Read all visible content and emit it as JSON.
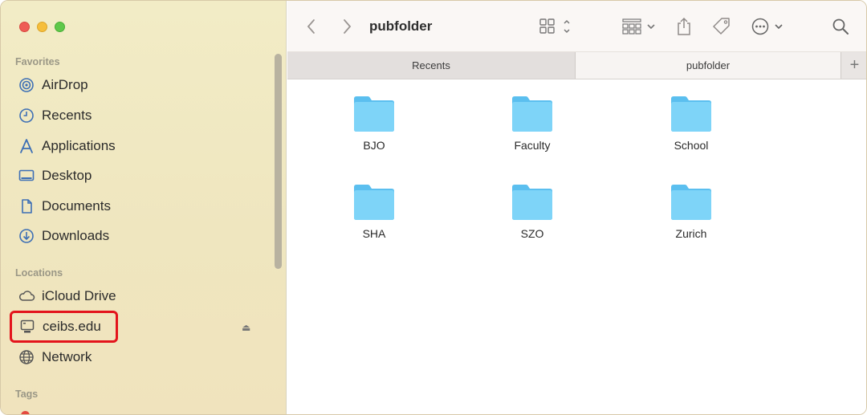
{
  "sidebar": {
    "favorites_title": "Favorites",
    "favorites": [
      {
        "label": "AirDrop",
        "icon": "airdrop-icon"
      },
      {
        "label": "Recents",
        "icon": "clock-icon"
      },
      {
        "label": "Applications",
        "icon": "applications-icon"
      },
      {
        "label": "Desktop",
        "icon": "desktop-icon"
      },
      {
        "label": "Documents",
        "icon": "document-icon"
      },
      {
        "label": "Downloads",
        "icon": "download-icon"
      }
    ],
    "locations_title": "Locations",
    "locations": [
      {
        "label": "iCloud Drive",
        "icon": "cloud-icon"
      },
      {
        "label": "ceibs.edu",
        "icon": "server-icon"
      },
      {
        "label": "Network",
        "icon": "globe-icon"
      }
    ],
    "tags_title": "Tags"
  },
  "toolbar": {
    "title": "pubfolder"
  },
  "tabs": {
    "items": [
      {
        "label": "Recents"
      },
      {
        "label": "pubfolder"
      }
    ],
    "add_label": "+"
  },
  "folders": [
    {
      "label": "BJO"
    },
    {
      "label": "Faculty"
    },
    {
      "label": "School"
    },
    {
      "label": "SHA"
    },
    {
      "label": "SZO"
    },
    {
      "label": "Zurich"
    }
  ],
  "colors": {
    "highlight": "#e3141c",
    "folder": "#6fcdf6"
  }
}
